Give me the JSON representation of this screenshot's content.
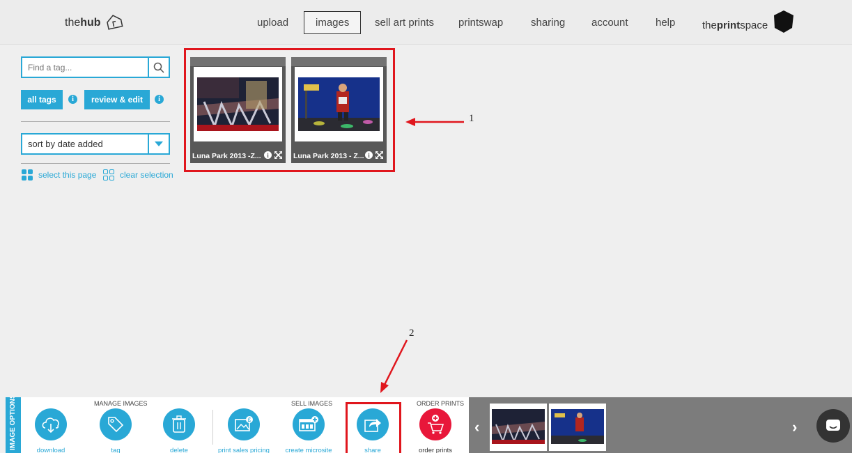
{
  "header": {
    "brand_prefix": "the",
    "brand_bold": "hub",
    "nav": [
      "upload",
      "images",
      "sell art prints",
      "printswap",
      "sharing",
      "account",
      "help"
    ],
    "active_nav": "images",
    "partner_prefix": "the",
    "partner_bold": "print",
    "partner_suffix": "space"
  },
  "sidebar": {
    "search_placeholder": "Find a tag...",
    "all_tags_label": "all tags",
    "review_edit_label": "review & edit",
    "info_glyph": "i",
    "sort_value": "sort by date added",
    "select_page_label": "select this page",
    "clear_selection_label": "clear selection"
  },
  "images": [
    {
      "caption": "Luna Park 2013 -Z...",
      "icons": [
        "info-icon",
        "expand-icon"
      ]
    },
    {
      "caption": "Luna Park 2013 - Z...",
      "icons": [
        "info-icon",
        "expand-icon"
      ]
    }
  ],
  "annotations": {
    "one": "1",
    "two": "2"
  },
  "toolbar": {
    "side_label": "IMAGE OPTIONS",
    "manage_title": "MANAGE IMAGES",
    "sell_title": "SELL IMAGES",
    "order_title": "ORDER PRINTS",
    "tools": [
      {
        "label": "download",
        "icon": "cloud-download-icon"
      },
      {
        "label": "tag",
        "icon": "tag-icon"
      },
      {
        "label": "delete",
        "icon": "trash-icon"
      },
      {
        "label": "print sales pricing",
        "icon": "image-price-icon"
      },
      {
        "label": "create microsite",
        "icon": "microsite-icon"
      },
      {
        "label": "share",
        "icon": "share-arrow-icon"
      },
      {
        "label": "order prints",
        "icon": "cart-add-icon"
      }
    ]
  },
  "colors": {
    "accent": "#29a8d6",
    "highlight_red": "#e0161d",
    "order_red": "#e8173a",
    "strip_gray": "#7c7c7c"
  }
}
